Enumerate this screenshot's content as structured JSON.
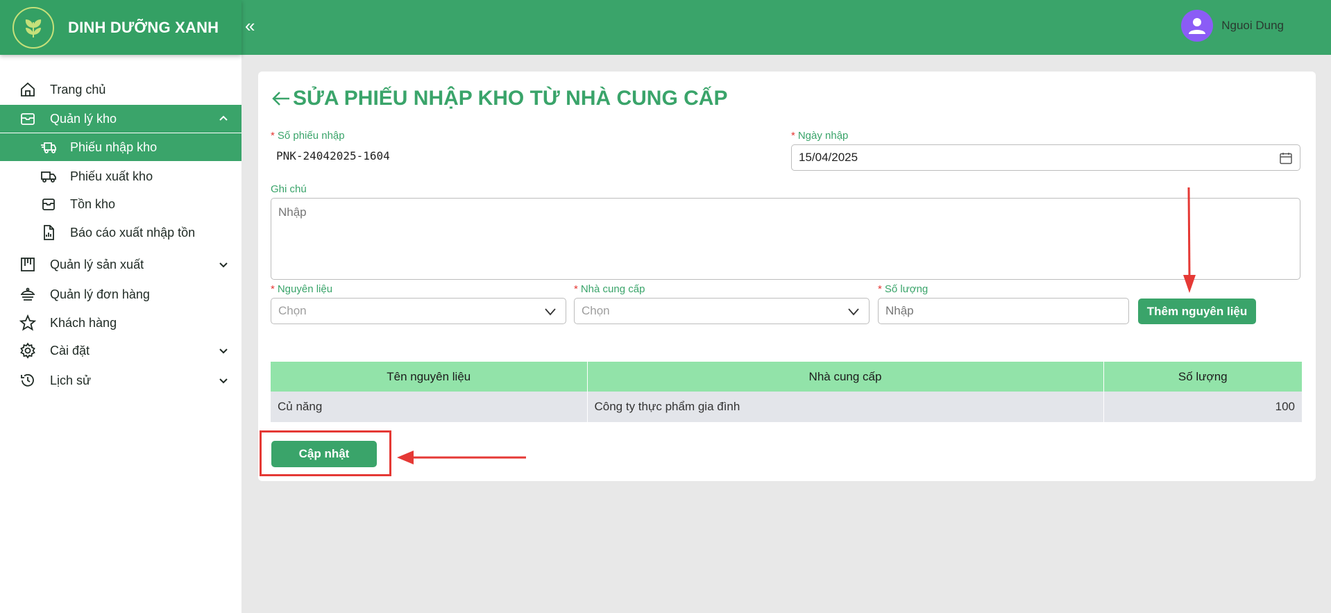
{
  "brand": {
    "name": "DINH DƯỠNG XANH",
    "collapse_glyph": "«"
  },
  "user": {
    "name": "Nguoi Dung"
  },
  "sidebar": {
    "items": [
      {
        "label": "Trang chủ",
        "icon": "home-icon"
      },
      {
        "label": "Quản lý kho",
        "icon": "box-icon",
        "expanded": true
      },
      {
        "label": "Phiếu nhập kho",
        "icon": "truck-import-icon",
        "active": true
      },
      {
        "label": "Phiếu xuất kho",
        "icon": "truck-export-icon"
      },
      {
        "label": "Tồn kho",
        "icon": "inventory-icon"
      },
      {
        "label": "Báo cáo xuất nhập tồn",
        "icon": "report-icon"
      },
      {
        "label": "Quản lý sản xuất",
        "icon": "factory-icon"
      },
      {
        "label": "Quản lý đơn hàng",
        "icon": "order-icon"
      },
      {
        "label": "Khách hàng",
        "icon": "star-icon"
      },
      {
        "label": "Cài đặt",
        "icon": "gear-icon"
      },
      {
        "label": "Lịch sử",
        "icon": "history-icon"
      }
    ]
  },
  "page": {
    "title": "SỬA PHIẾU NHẬP KHO TỪ NHÀ CUNG CẤP",
    "fields": {
      "receipt_no_label": "Số phiếu nhập",
      "receipt_no_value": "PNK-24042025-1604",
      "date_label": "Ngày nhập",
      "date_value": "15/04/2025",
      "note_label": "Ghi chú",
      "note_placeholder": "Nhập",
      "material_label": "Nguyên liệu",
      "material_placeholder": "Chọn",
      "supplier_label": "Nhà cung cấp",
      "supplier_placeholder": "Chọn",
      "quantity_label": "Số lượng",
      "quantity_placeholder": "Nhập"
    },
    "add_button": "Thêm nguyên liệu",
    "update_button": "Cập nhật",
    "table": {
      "headers": [
        "Tên nguyên liệu",
        "Nhà cung cấp",
        "Số lượng"
      ],
      "rows": [
        [
          "Củ năng",
          "Công ty thực phẩm gia đình",
          "100"
        ]
      ]
    }
  },
  "colors": {
    "primary": "#3aa46a",
    "table_header": "#92e3a9",
    "annotation": "#e53935"
  }
}
